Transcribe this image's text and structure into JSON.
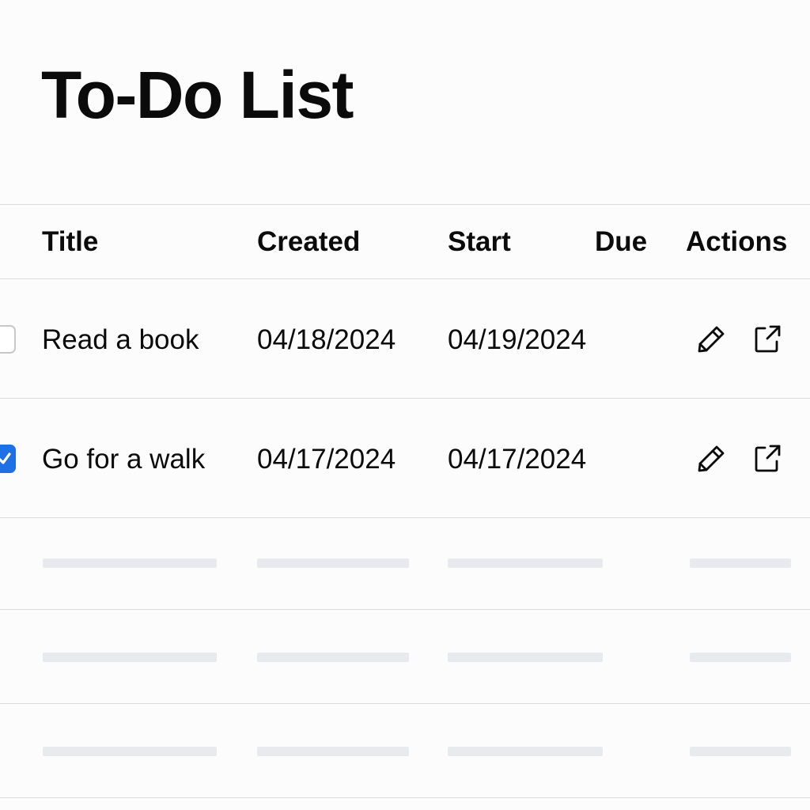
{
  "page": {
    "title": "To-Do List"
  },
  "table": {
    "headers": {
      "title": "Title",
      "created": "Created",
      "start": "Start",
      "due": "Due",
      "actions": "Actions"
    },
    "rows": [
      {
        "checked": false,
        "title": "Read a book",
        "created": "04/18/2024",
        "start": "04/19/2024",
        "due": "",
        "actions": [
          "pencil-icon",
          "open-external-icon"
        ]
      },
      {
        "checked": true,
        "title": "Go for a walk",
        "created": "04/17/2024",
        "start": "04/17/2024",
        "due": "",
        "actions": [
          "pencil-icon",
          "open-external-icon"
        ]
      }
    ],
    "placeholder_rows": 3
  },
  "colors": {
    "accent": "#1f6fe5",
    "divider": "#dcdcdc",
    "placeholder": "#e8eaee",
    "text": "#0b0b0b"
  }
}
